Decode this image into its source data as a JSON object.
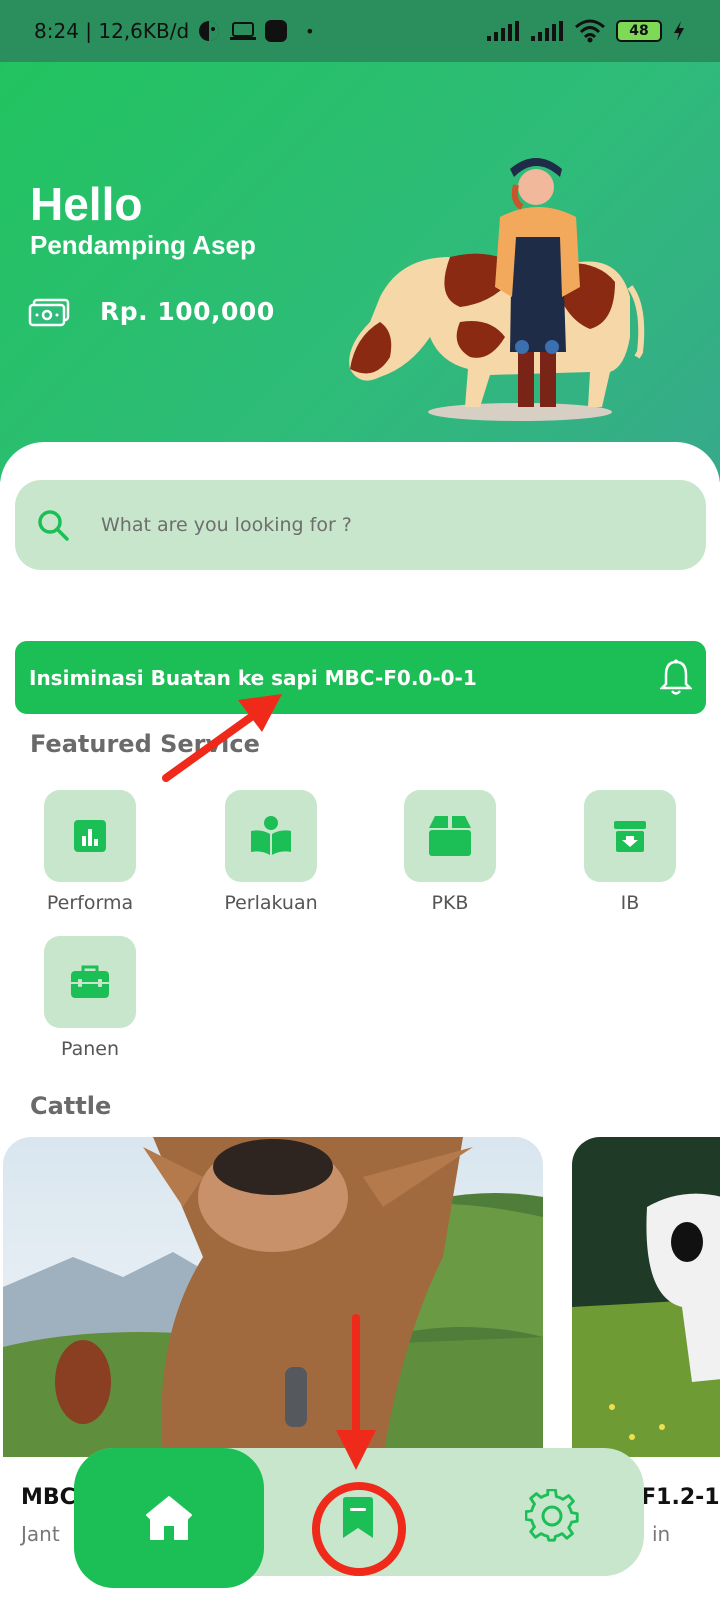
{
  "status_bar": {
    "time_info": "8:24 | 12,6KB/d",
    "battery": "48",
    "icons": [
      "face-icon",
      "laptop-icon",
      "app-icon",
      "signal-icon",
      "signal-icon",
      "wifi-icon",
      "charging-icon"
    ]
  },
  "header": {
    "greeting": "Hello",
    "user": "Pendamping Asep",
    "balance": "Rp. 100,000",
    "balance_icon": "cash-icon",
    "illustration": "farmer-with-cow"
  },
  "search": {
    "placeholder": "What are you looking for ?"
  },
  "banner": {
    "text": "Insiminasi Buatan ke sapi MBC-F0.0-0-1",
    "icon": "bell-icon"
  },
  "featured": {
    "title": "Featured Service",
    "items": [
      {
        "label": "Performa",
        "icon": "chart-icon"
      },
      {
        "label": "Perlakuan",
        "icon": "reading-person-icon"
      },
      {
        "label": "PKB",
        "icon": "box-icon"
      },
      {
        "label": "IB",
        "icon": "download-box-icon"
      },
      {
        "label": "Panen",
        "icon": "briefcase-icon"
      }
    ]
  },
  "cattle": {
    "title": "Cattle",
    "cards": [
      {
        "title": "MBC",
        "subtitle": "Jant"
      },
      {
        "title": "-F1.2-1",
        "subtitle": "in"
      }
    ]
  },
  "bottom_nav": {
    "items": [
      "home-icon",
      "bookmark-icon",
      "gear-icon"
    ]
  },
  "colors": {
    "primary": "#1bbf55",
    "light_green": "#c8e6cc",
    "annotation_red": "#ef2a1a"
  }
}
